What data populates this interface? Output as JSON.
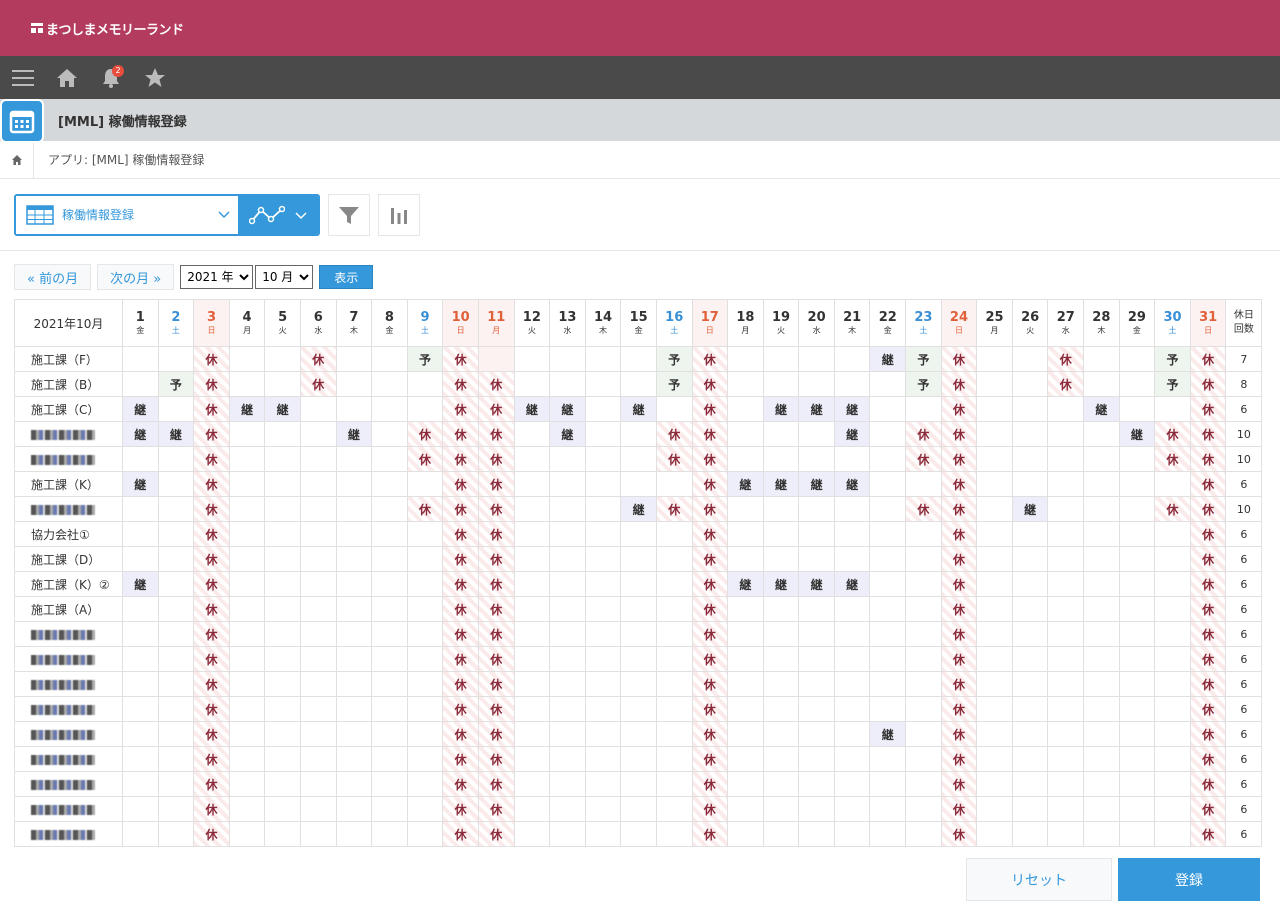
{
  "header": {
    "brand": "まつしまメモリーランド"
  },
  "nav": {
    "notification_count": "2"
  },
  "app": {
    "title": "[MML] 稼働情報登録"
  },
  "breadcrumb": {
    "path": "アプリ: [MML] 稼働情報登録"
  },
  "toolbar": {
    "view_name": "稼働情報登録"
  },
  "monthnav": {
    "prev": "« 前の月",
    "next": "次の月 »",
    "year": "2021 年",
    "month": "10 月",
    "show": "表示"
  },
  "calendar": {
    "corner": "2021年10月",
    "last_header": "休日回数",
    "days": [
      {
        "d": "1",
        "w": "金",
        "t": ""
      },
      {
        "d": "2",
        "w": "土",
        "t": "sat"
      },
      {
        "d": "3",
        "w": "日",
        "t": "hol"
      },
      {
        "d": "4",
        "w": "月",
        "t": ""
      },
      {
        "d": "5",
        "w": "火",
        "t": ""
      },
      {
        "d": "6",
        "w": "水",
        "t": ""
      },
      {
        "d": "7",
        "w": "木",
        "t": ""
      },
      {
        "d": "8",
        "w": "金",
        "t": ""
      },
      {
        "d": "9",
        "w": "土",
        "t": "sat"
      },
      {
        "d": "10",
        "w": "日",
        "t": "hol"
      },
      {
        "d": "11",
        "w": "月",
        "t": "hol"
      },
      {
        "d": "12",
        "w": "火",
        "t": ""
      },
      {
        "d": "13",
        "w": "水",
        "t": ""
      },
      {
        "d": "14",
        "w": "木",
        "t": ""
      },
      {
        "d": "15",
        "w": "金",
        "t": ""
      },
      {
        "d": "16",
        "w": "土",
        "t": "sat"
      },
      {
        "d": "17",
        "w": "日",
        "t": "hol"
      },
      {
        "d": "18",
        "w": "月",
        "t": ""
      },
      {
        "d": "19",
        "w": "火",
        "t": ""
      },
      {
        "d": "20",
        "w": "水",
        "t": ""
      },
      {
        "d": "21",
        "w": "木",
        "t": ""
      },
      {
        "d": "22",
        "w": "金",
        "t": ""
      },
      {
        "d": "23",
        "w": "土",
        "t": "sat"
      },
      {
        "d": "24",
        "w": "日",
        "t": "hol"
      },
      {
        "d": "25",
        "w": "月",
        "t": ""
      },
      {
        "d": "26",
        "w": "火",
        "t": ""
      },
      {
        "d": "27",
        "w": "水",
        "t": ""
      },
      {
        "d": "28",
        "w": "木",
        "t": ""
      },
      {
        "d": "29",
        "w": "金",
        "t": ""
      },
      {
        "d": "30",
        "w": "土",
        "t": "sat"
      },
      {
        "d": "31",
        "w": "日",
        "t": "hol"
      }
    ],
    "rows": [
      {
        "name": "施工課（F）",
        "cells": {
          "3": "休",
          "6": "休",
          "9": "予",
          "10": "休",
          "16": "予",
          "17": "休",
          "22": "継",
          "23": "予",
          "24": "休",
          "27": "休",
          "30": "予",
          "31": "休"
        },
        "count": "7"
      },
      {
        "name": "施工課（B）",
        "cells": {
          "2": "予",
          "3": "休",
          "6": "休",
          "10": "休",
          "11": "休",
          "16": "予",
          "17": "休",
          "23": "予",
          "24": "休",
          "27": "休",
          "30": "予",
          "31": "休"
        },
        "count": "8"
      },
      {
        "name": "施工課（C）",
        "cells": {
          "1": "継",
          "3": "休",
          "4": "継",
          "5": "継",
          "10": "休",
          "11": "休",
          "12": "継",
          "13": "継",
          "15": "継",
          "17": "休",
          "19": "継",
          "20": "継",
          "21": "継",
          "24": "休",
          "28": "継",
          "31": "休"
        },
        "count": "6"
      },
      {
        "name": "",
        "blur": true,
        "cells": {
          "1": "継",
          "2": "継",
          "3": "休",
          "7": "継",
          "9": "休",
          "10": "休",
          "11": "休",
          "13": "継",
          "16": "休",
          "17": "休",
          "21": "継",
          "23": "休",
          "24": "休",
          "29": "継",
          "30": "休",
          "31": "休"
        },
        "count": "10"
      },
      {
        "name": "",
        "blur": true,
        "cells": {
          "3": "休",
          "9": "休",
          "10": "休",
          "11": "休",
          "16": "休",
          "17": "休",
          "23": "休",
          "24": "休",
          "30": "休",
          "31": "休"
        },
        "count": "10"
      },
      {
        "name": "施工課（K）",
        "cells": {
          "1": "継",
          "3": "休",
          "10": "休",
          "11": "休",
          "17": "休",
          "18": "継",
          "19": "継",
          "20": "継",
          "21": "継",
          "24": "休",
          "31": "休"
        },
        "count": "6"
      },
      {
        "name": "",
        "blur": true,
        "cells": {
          "3": "休",
          "9": "休",
          "10": "休",
          "11": "休",
          "15": "継",
          "16": "休",
          "17": "休",
          "23": "休",
          "24": "休",
          "26": "継",
          "30": "休",
          "31": "休"
        },
        "count": "10"
      },
      {
        "name": "協力会社①",
        "cells": {
          "3": "休",
          "10": "休",
          "11": "休",
          "17": "休",
          "24": "休",
          "31": "休"
        },
        "count": "6"
      },
      {
        "name": "施工課（D）",
        "cells": {
          "3": "休",
          "10": "休",
          "11": "休",
          "17": "休",
          "24": "休",
          "31": "休"
        },
        "count": "6"
      },
      {
        "name": "施工課（K）②",
        "cells": {
          "1": "継",
          "3": "休",
          "10": "休",
          "11": "休",
          "17": "休",
          "18": "継",
          "19": "継",
          "20": "継",
          "21": "継",
          "24": "休",
          "31": "休"
        },
        "count": "6"
      },
      {
        "name": "施工課（A）",
        "cells": {
          "3": "休",
          "10": "休",
          "11": "休",
          "17": "休",
          "24": "休",
          "31": "休"
        },
        "count": "6"
      },
      {
        "name": "",
        "blur": true,
        "cells": {
          "3": "休",
          "10": "休",
          "11": "休",
          "17": "休",
          "24": "休",
          "31": "休"
        },
        "count": "6"
      },
      {
        "name": "",
        "blur": true,
        "cells": {
          "3": "休",
          "10": "休",
          "11": "休",
          "17": "休",
          "24": "休",
          "31": "休"
        },
        "count": "6"
      },
      {
        "name": "",
        "blur": true,
        "cells": {
          "3": "休",
          "10": "休",
          "11": "休",
          "17": "休",
          "24": "休",
          "31": "休"
        },
        "count": "6"
      },
      {
        "name": "",
        "blur": true,
        "cells": {
          "3": "休",
          "10": "休",
          "11": "休",
          "17": "休",
          "24": "休",
          "31": "休"
        },
        "count": "6"
      },
      {
        "name": "",
        "blur": true,
        "cells": {
          "3": "休",
          "10": "休",
          "11": "休",
          "17": "休",
          "22": "継",
          "24": "休",
          "31": "休"
        },
        "count": "6"
      },
      {
        "name": "",
        "blur": true,
        "cells": {
          "3": "休",
          "10": "休",
          "11": "休",
          "17": "休",
          "24": "休",
          "31": "休"
        },
        "count": "6"
      },
      {
        "name": "",
        "blur": true,
        "cells": {
          "3": "休",
          "10": "休",
          "11": "休",
          "17": "休",
          "24": "休",
          "31": "休"
        },
        "count": "6"
      },
      {
        "name": "",
        "blur": true,
        "cells": {
          "3": "休",
          "10": "休",
          "11": "休",
          "17": "休",
          "24": "休",
          "31": "休"
        },
        "count": "6"
      },
      {
        "name": "",
        "blur": true,
        "cells": {
          "3": "休",
          "10": "休",
          "11": "休",
          "17": "休",
          "24": "休",
          "31": "休"
        },
        "count": "6"
      }
    ]
  },
  "footer": {
    "reset": "リセット",
    "save": "登録"
  }
}
